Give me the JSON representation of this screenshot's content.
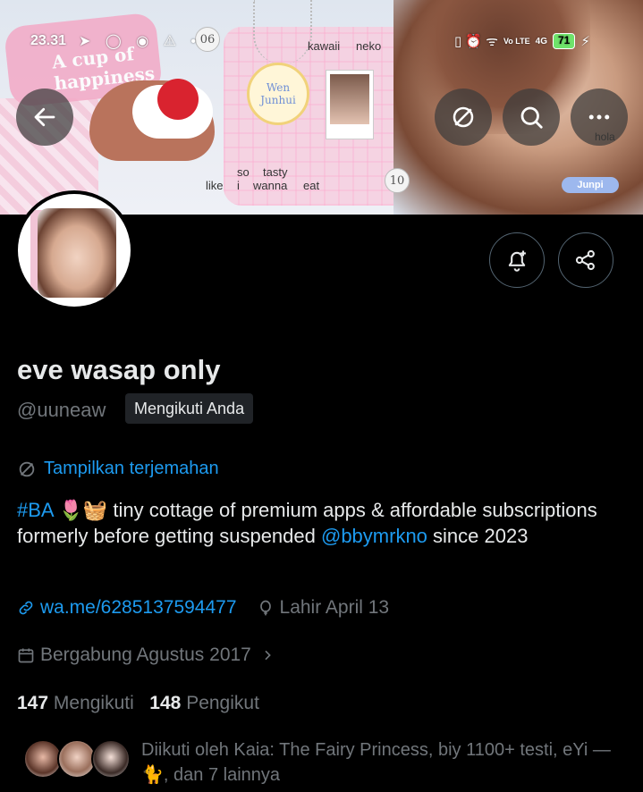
{
  "status_bar": {
    "time": "23.31",
    "left_icons": "➤ ◯ ◉ ⚠ •",
    "right_icons": "▯ ⏰ ᯤ",
    "volte": "Vo LTE",
    "network": "4G",
    "battery": "71"
  },
  "banner": {
    "cup_text": "A cup of happiness",
    "badge_text": "Wen Junhui",
    "word_kawaii": "kawaii",
    "word_neko": "neko",
    "word_so": "so",
    "word_tasty": "tasty",
    "word_like": "like",
    "word_i": "i",
    "word_wanna": "wanna",
    "word_eat": "eat",
    "num_06": "06",
    "num_10": "10",
    "junpi": "Junpi",
    "hola": "hola"
  },
  "profile": {
    "display_name": "eve wasap only",
    "handle": "@uuneaw",
    "follows_you_label": "Mengikuti Anda",
    "translate_label": "Tampilkan terjemahan",
    "bio": {
      "hashtag": "#BA",
      "emoji": "🌷🧺",
      "text_1": " tiny cottage of premium apps & affordable subscriptions formerly before getting suspended ",
      "mention": "@bbymrkno",
      "text_2": " since 2023"
    },
    "website": "wa.me/6285137594477",
    "birthday": "Lahir April 13",
    "joined": "Bergabung Agustus 2017",
    "following_count": "147",
    "following_label": "Mengikuti",
    "followers_count": "148",
    "followers_label": "Pengikut",
    "followed_by_text": "Diikuti oleh Kaia: The Fairy Princess, biy 1100+ testi, eYi — 🐈, dan 7 lainnya"
  },
  "colors": {
    "accent": "#1d9bf0",
    "muted": "#71767b",
    "text": "#e7e9ea",
    "background": "#000000"
  }
}
